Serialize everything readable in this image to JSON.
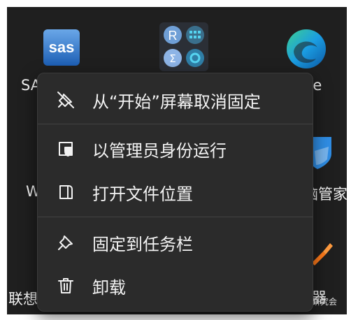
{
  "desktop": {
    "apps": [
      {
        "name": "sas-app",
        "logo_text": "sas",
        "label": "SA"
      },
      {
        "name": "r-studio-app",
        "logo_text": "R",
        "label": ""
      },
      {
        "name": "edge-app",
        "label": "ge"
      },
      {
        "name": "w-app",
        "label": "W"
      },
      {
        "name": "pc-manager-app",
        "label": "脑管家"
      },
      {
        "name": "lenovo-app",
        "label": "联想"
      },
      {
        "name": "tool-app",
        "label": "器"
      }
    ]
  },
  "context_menu": {
    "items": [
      {
        "label": "从“开始”屏幕取消固定",
        "icon": "unpin-icon"
      },
      {
        "label": "以管理员身份运行",
        "icon": "shield-icon"
      },
      {
        "label": "打开文件位置",
        "icon": "folder-icon"
      },
      {
        "label": "固定到任务栏",
        "icon": "pin-icon"
      },
      {
        "label": "卸载",
        "icon": "trash-icon"
      }
    ]
  },
  "watermark": {
    "text": "统计研究会",
    "icon": "wechat-icon"
  }
}
